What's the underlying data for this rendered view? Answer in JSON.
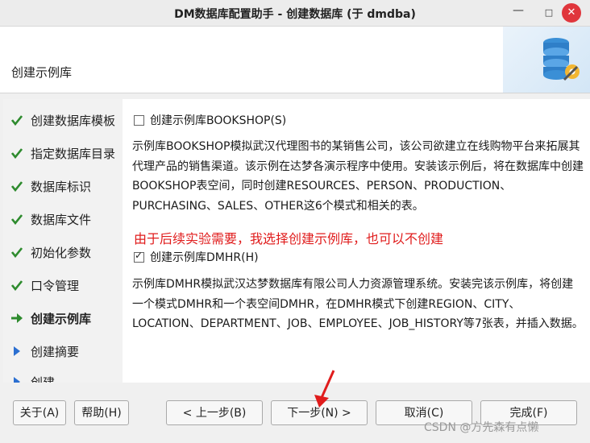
{
  "window": {
    "title": "DM数据库配置助手 - 创建数据库 (于 dmdba)",
    "minimize_glyph": "—",
    "maximize_glyph": "□",
    "close_glyph": "✕"
  },
  "header": {
    "heading": "创建示例库",
    "banner_icon": "database-gear-icon"
  },
  "sidebar": {
    "steps": [
      {
        "label": "创建数据库模板",
        "status": "done"
      },
      {
        "label": "指定数据库目录",
        "status": "done"
      },
      {
        "label": "数据库标识",
        "status": "done"
      },
      {
        "label": "数据库文件",
        "status": "done"
      },
      {
        "label": "初始化参数",
        "status": "done"
      },
      {
        "label": "口令管理",
        "status": "done"
      },
      {
        "label": "创建示例库",
        "status": "current"
      },
      {
        "label": "创建摘要",
        "status": "pending"
      },
      {
        "label": "创建",
        "status": "pending"
      }
    ],
    "status_colors": {
      "done": "#2e8b2e",
      "current": "#2e8b2e",
      "pending": "#2b6fd1"
    }
  },
  "content": {
    "bookshop_checkbox": {
      "label": "创建示例库BOOKSHOP(S)",
      "checked": false
    },
    "bookshop_description": "示例库BOOKSHOP模拟武汉代理图书的某销售公司，该公司欲建立在线购物平台来拓展其代理产品的销售渠道。该示例在达梦各演示程序中使用。安装该示例后，将在数据库中创建BOOKSHOP表空间，同时创建RESOURCES、PERSON、PRODUCTION、PURCHASING、SALES、OTHER这6个模式和相关的表。",
    "annotation": "由于后续实验需要，我选择创建示例库，也可以不创建",
    "dmhr_checkbox": {
      "label": "创建示例库DMHR(H)",
      "checked": true
    },
    "dmhr_description": "示例库DMHR模拟武汉达梦数据库有限公司人力资源管理系统。安装完该示例库，将创建一个模式DMHR和一个表空间DMHR，在DMHR模式下创建REGION、CITY、LOCATION、DEPARTMENT、JOB、EMPLOYEE、JOB_HISTORY等7张表，并插入数据。"
  },
  "buttons": {
    "about": "关于(A)",
    "help": "帮助(H)",
    "back": "< 上一步(B)",
    "next": "下一步(N) >",
    "cancel": "取消(C)",
    "finish": "完成(F)"
  },
  "watermark": "CSDN @方先森有点懒",
  "colors": {
    "annotation": "#e01c1c",
    "arrow": "#e01c1c"
  }
}
